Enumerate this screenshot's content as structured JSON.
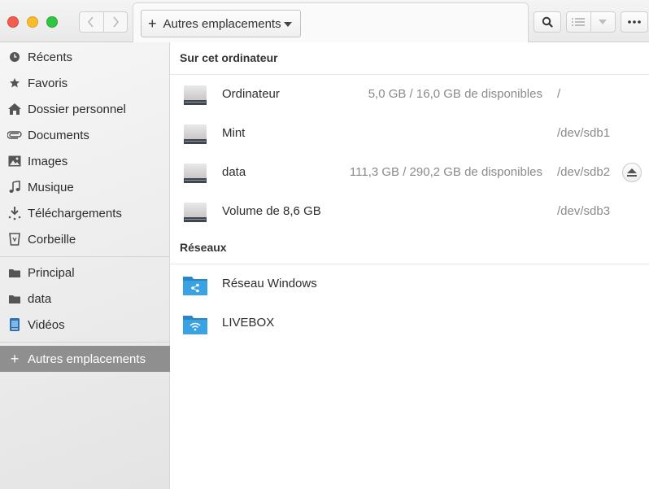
{
  "window": {
    "controls": [
      "close",
      "minimize",
      "maximize"
    ]
  },
  "toolbar": {
    "back_icon": "chevron-left-icon",
    "forward_icon": "chevron-right-icon",
    "path_button_label": "Autres emplacements",
    "search_icon": "search-icon",
    "view_icon": "list-view-icon",
    "view_options_icon": "chevron-down-icon",
    "menu_icon": "more-horizontal-icon"
  },
  "sidebar": {
    "items": [
      {
        "label": "Récents",
        "icon": "clock-icon"
      },
      {
        "label": "Favoris",
        "icon": "star-icon"
      },
      {
        "label": "Dossier personnel",
        "icon": "home-icon"
      },
      {
        "label": "Documents",
        "icon": "paperclip-icon"
      },
      {
        "label": "Images",
        "icon": "image-icon"
      },
      {
        "label": "Musique",
        "icon": "music-icon"
      },
      {
        "label": "Téléchargements",
        "icon": "download-icon"
      },
      {
        "label": "Corbeille",
        "icon": "trash-icon"
      },
      {
        "label": "Principal",
        "icon": "folder-icon"
      },
      {
        "label": "data",
        "icon": "folder-icon"
      },
      {
        "label": "Vidéos",
        "icon": "video-icon"
      },
      {
        "label": "Autres emplacements",
        "icon": "plus-icon",
        "selected": true
      }
    ]
  },
  "main": {
    "computer_section": {
      "title": "Sur cet ordinateur",
      "rows": [
        {
          "name": "Ordinateur",
          "space": "5,0 GB / 16,0 GB de disponibles",
          "path": "/",
          "eject": false
        },
        {
          "name": "Mint",
          "space": "",
          "path": "/dev/sdb1",
          "eject": false
        },
        {
          "name": "data",
          "space": "111,3 GB / 290,2 GB de disponibles",
          "path": "/dev/sdb2",
          "eject": true
        },
        {
          "name": "Volume de 8,6 GB",
          "space": "",
          "path": "/dev/sdb3",
          "eject": false
        }
      ]
    },
    "network_section": {
      "title": "Réseaux",
      "rows": [
        {
          "name": "Réseau Windows",
          "icon": "network-share-folder-icon"
        },
        {
          "name": "LIVEBOX",
          "icon": "wifi-folder-icon"
        }
      ]
    }
  },
  "colors": {
    "selected_bg": "#8f8f8f",
    "folder_blue": "#3aa2e3",
    "close": "#f45c4f",
    "minimize": "#f8bd2d",
    "maximize": "#30c740"
  }
}
